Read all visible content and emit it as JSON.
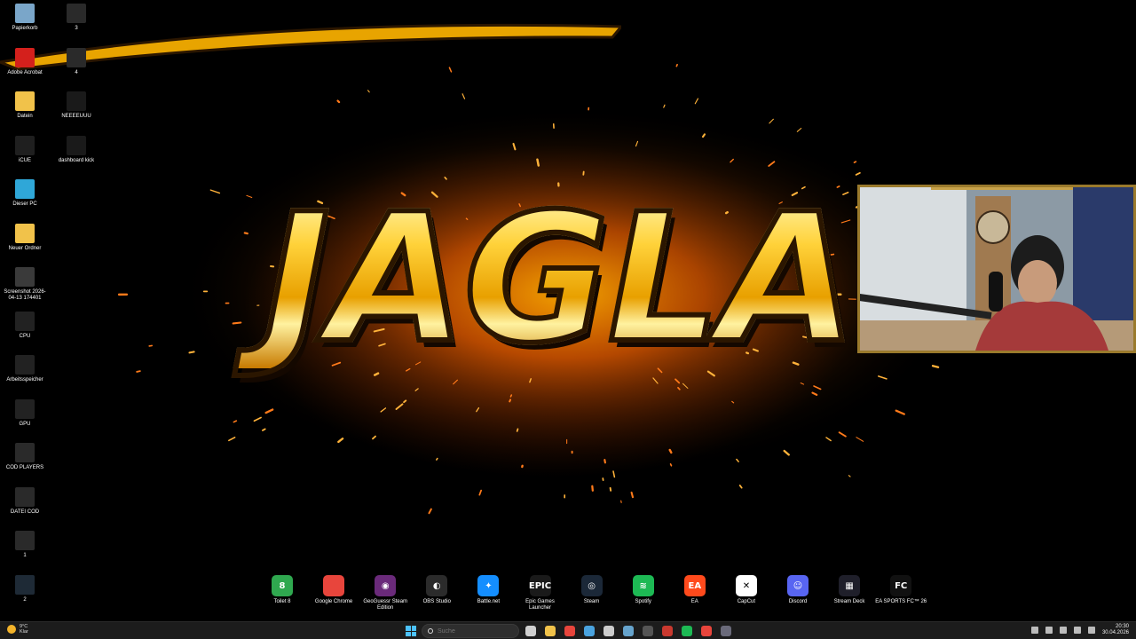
{
  "desktop": {
    "icons_col1": [
      {
        "label": "Papierkorb",
        "icon": "recycle-bin-icon",
        "color": "#7aa6c9"
      },
      {
        "label": "Adobe Acrobat",
        "icon": "acrobat-icon",
        "color": "#d4201c"
      },
      {
        "label": "Datein",
        "icon": "folder-icon",
        "color": "#f1c24a"
      },
      {
        "label": "iCUE",
        "icon": "icue-icon",
        "color": "#1f1f1f"
      },
      {
        "label": "Dieser PC",
        "icon": "this-pc-icon",
        "color": "#2fa7d8"
      },
      {
        "label": "Neuer Ordner",
        "icon": "folder-icon",
        "color": "#f1c24a"
      },
      {
        "label": "Screenshot 2026-04-13 174401",
        "icon": "image-file-icon",
        "color": "#3a3a3a"
      },
      {
        "label": "CPU",
        "icon": "shortcut-icon",
        "color": "#222222"
      },
      {
        "label": "Arbeitsspeicher",
        "icon": "shortcut-icon",
        "color": "#222222"
      },
      {
        "label": "GPU",
        "icon": "shortcut-icon",
        "color": "#222222"
      },
      {
        "label": "COD PLAYERS",
        "icon": "shortcut-icon",
        "color": "#2a2a2a"
      },
      {
        "label": "DATEI COD",
        "icon": "shortcut-icon",
        "color": "#2a2a2a"
      },
      {
        "label": "1",
        "icon": "shortcut-icon",
        "color": "#2a2a2a"
      },
      {
        "label": "2",
        "icon": "shortcut-icon",
        "color": "#1e2a36"
      }
    ],
    "icons_col2": [
      {
        "label": "3",
        "icon": "shortcut-icon",
        "color": "#2a2a2a"
      },
      {
        "label": "4",
        "icon": "shortcut-icon",
        "color": "#2a2a2a"
      },
      {
        "label": "NEEEEUUU",
        "icon": "shortcut-icon",
        "color": "#1a1a1a"
      },
      {
        "label": "dashboard kick",
        "icon": "shortcut-icon",
        "color": "#1a1a1a"
      }
    ]
  },
  "wallpaper": {
    "logo_text": "JAGLA",
    "accent": "#ffc21a"
  },
  "dock": {
    "items": [
      {
        "label": "Toilet 8",
        "icon": "toilet8-icon",
        "color": "#2fa84f",
        "glyph": "8"
      },
      {
        "label": "Google Chrome",
        "icon": "chrome-icon",
        "color": "#e8453c",
        "glyph": ""
      },
      {
        "label": "GeoGuessr Steam Edition",
        "icon": "geoguessr-icon",
        "color": "#6a2a7a",
        "glyph": "◉"
      },
      {
        "label": "OBS Studio",
        "icon": "obs-icon",
        "color": "#2b2b2b",
        "glyph": "◐"
      },
      {
        "label": "Battle.net",
        "icon": "battlenet-icon",
        "color": "#148eff",
        "glyph": "✦"
      },
      {
        "label": "Epic Games Launcher",
        "icon": "epic-games-icon",
        "color": "#1a1a1a",
        "glyph": "EPIC"
      },
      {
        "label": "Steam",
        "icon": "steam-icon",
        "color": "#1b2838",
        "glyph": "◎"
      },
      {
        "label": "Spotify",
        "icon": "spotify-icon",
        "color": "#1db954",
        "glyph": "≋"
      },
      {
        "label": "EA",
        "icon": "ea-icon",
        "color": "#ff4a1c",
        "glyph": "EA"
      },
      {
        "label": "CapCut",
        "icon": "capcut-icon",
        "color": "#ffffff",
        "glyph": "✕"
      },
      {
        "label": "Discord",
        "icon": "discord-icon",
        "color": "#5865f2",
        "glyph": "☺"
      },
      {
        "label": "Stream Deck",
        "icon": "stream-deck-icon",
        "color": "#1f1f2a",
        "glyph": "▦"
      },
      {
        "label": "EA SPORTS FC™ 26",
        "icon": "eafc-icon",
        "color": "#111111",
        "glyph": "FC"
      }
    ]
  },
  "taskbar": {
    "weather_temp": "9°C",
    "weather_desc": "Klar",
    "search_placeholder": "Suche",
    "clock_time": "20:30",
    "clock_date": "30.04.2026",
    "pinned": [
      {
        "icon": "task-view-icon",
        "color": "#cfcfcf"
      },
      {
        "icon": "file-explorer-icon",
        "color": "#f1c24a"
      },
      {
        "icon": "chrome-icon",
        "color": "#e8453c"
      },
      {
        "icon": "screenshot-tool-icon",
        "color": "#4aa3df"
      },
      {
        "icon": "store-icon",
        "color": "#cccccc"
      },
      {
        "icon": "steam-icon",
        "color": "#66a3cc"
      },
      {
        "icon": "obs-icon",
        "color": "#555555"
      },
      {
        "icon": "app-icon",
        "color": "#c9392f"
      },
      {
        "icon": "spotify-icon",
        "color": "#1db954"
      },
      {
        "icon": "chrome-icon",
        "color": "#e8453c"
      },
      {
        "icon": "app-icon",
        "color": "#6a6a7a"
      }
    ]
  }
}
